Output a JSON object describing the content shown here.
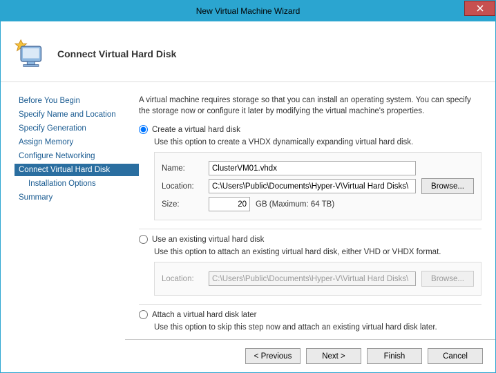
{
  "title": "New Virtual Machine Wizard",
  "header": "Connect Virtual Hard Disk",
  "sidebar": {
    "items": [
      {
        "label": "Before You Begin"
      },
      {
        "label": "Specify Name and Location"
      },
      {
        "label": "Specify Generation"
      },
      {
        "label": "Assign Memory"
      },
      {
        "label": "Configure Networking"
      },
      {
        "label": "Connect Virtual Hard Disk"
      },
      {
        "label": "Installation Options"
      },
      {
        "label": "Summary"
      }
    ]
  },
  "description": "A virtual machine requires storage so that you can install an operating system. You can specify the storage now or configure it later by modifying the virtual machine's properties.",
  "opt1": {
    "label": "Create a virtual hard disk",
    "desc": "Use this option to create a VHDX dynamically expanding virtual hard disk.",
    "name_label": "Name:",
    "name_value": "ClusterVM01.vhdx",
    "loc_label": "Location:",
    "loc_value": "C:\\Users\\Public\\Documents\\Hyper-V\\Virtual Hard Disks\\",
    "browse": "Browse...",
    "size_label": "Size:",
    "size_value": "20",
    "size_suffix": "GB (Maximum: 64 TB)"
  },
  "opt2": {
    "label": "Use an existing virtual hard disk",
    "desc": "Use this option to attach an existing virtual hard disk, either VHD or VHDX format.",
    "loc_label": "Location:",
    "loc_value": "C:\\Users\\Public\\Documents\\Hyper-V\\Virtual Hard Disks\\",
    "browse": "Browse..."
  },
  "opt3": {
    "label": "Attach a virtual hard disk later",
    "desc": "Use this option to skip this step now and attach an existing virtual hard disk later."
  },
  "footer": {
    "prev": "< Previous",
    "next": "Next >",
    "finish": "Finish",
    "cancel": "Cancel"
  }
}
